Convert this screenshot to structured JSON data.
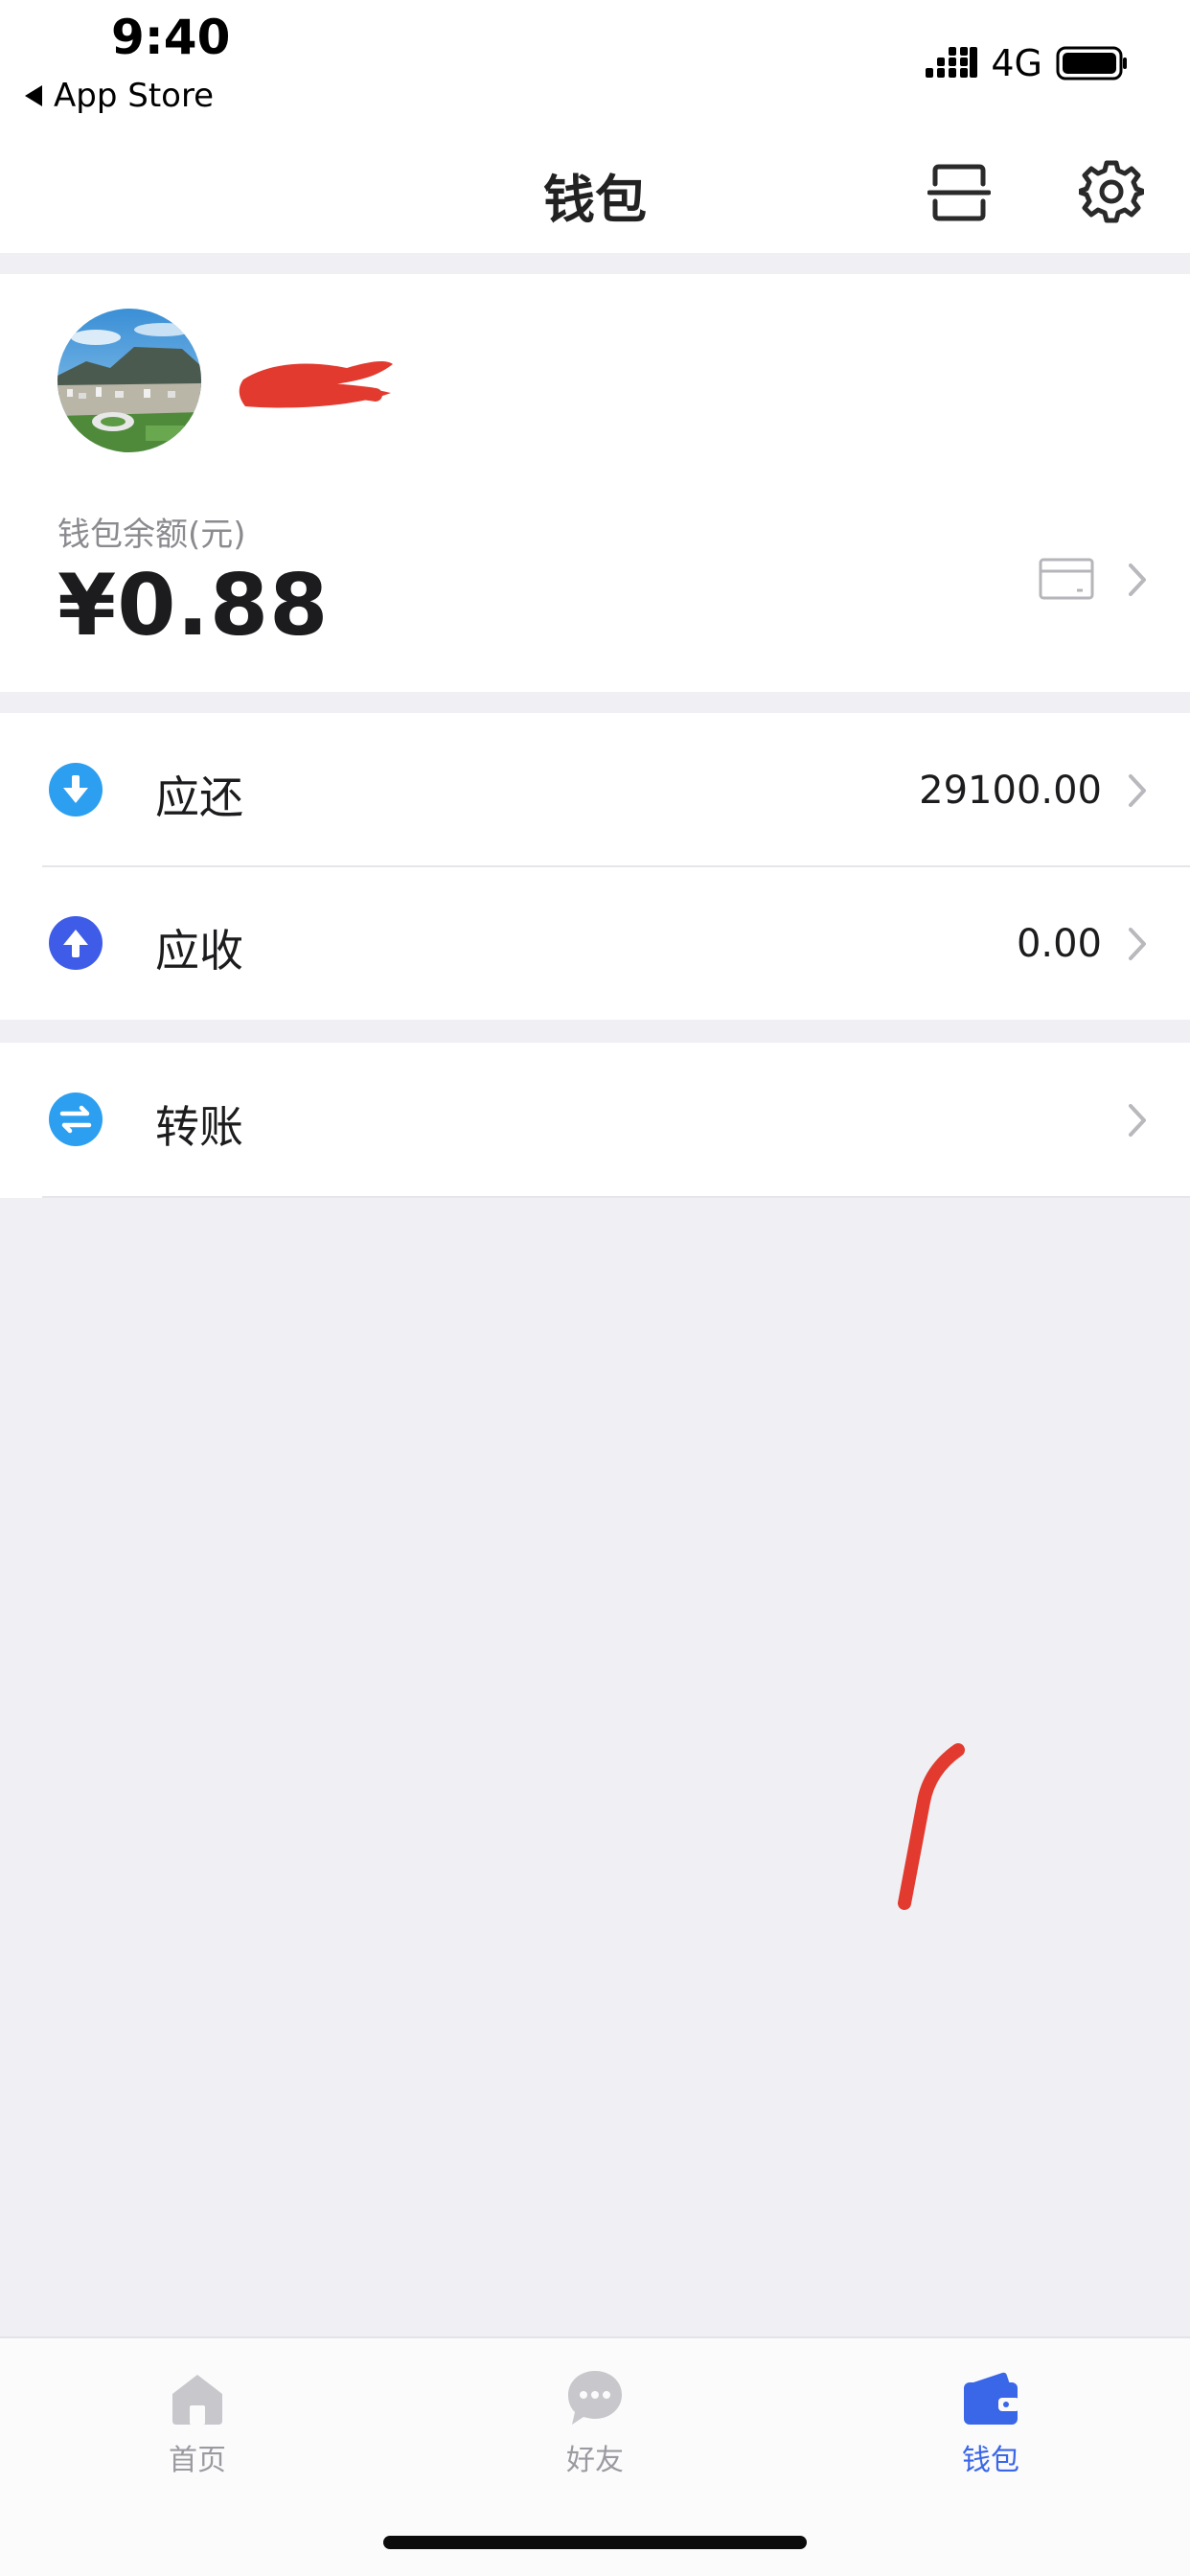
{
  "status_bar": {
    "time": "9:40",
    "back_app": "App Store",
    "network": "4G"
  },
  "nav": {
    "title": "钱包"
  },
  "profile": {
    "balance_label": "钱包余额(元)",
    "balance_amount": "¥0.88"
  },
  "rows": [
    {
      "label": "应还",
      "value": "29100.00",
      "icon": "arrow-down-circle-icon"
    },
    {
      "label": "应收",
      "value": "0.00",
      "icon": "arrow-up-circle-icon"
    },
    {
      "label": "转账",
      "value": "",
      "icon": "transfer-circle-icon"
    }
  ],
  "tabs": [
    {
      "label": "首页",
      "icon": "home-icon"
    },
    {
      "label": "好友",
      "icon": "chat-bubble-icon"
    },
    {
      "label": "钱包",
      "icon": "wallet-icon",
      "active": true
    }
  ],
  "colors": {
    "accent": "#3a66e8",
    "icon_light_blue": "#2c9ff0",
    "icon_indigo": "#3e5ce8",
    "redaction": "#e23a2e",
    "background": "#efeff4"
  }
}
